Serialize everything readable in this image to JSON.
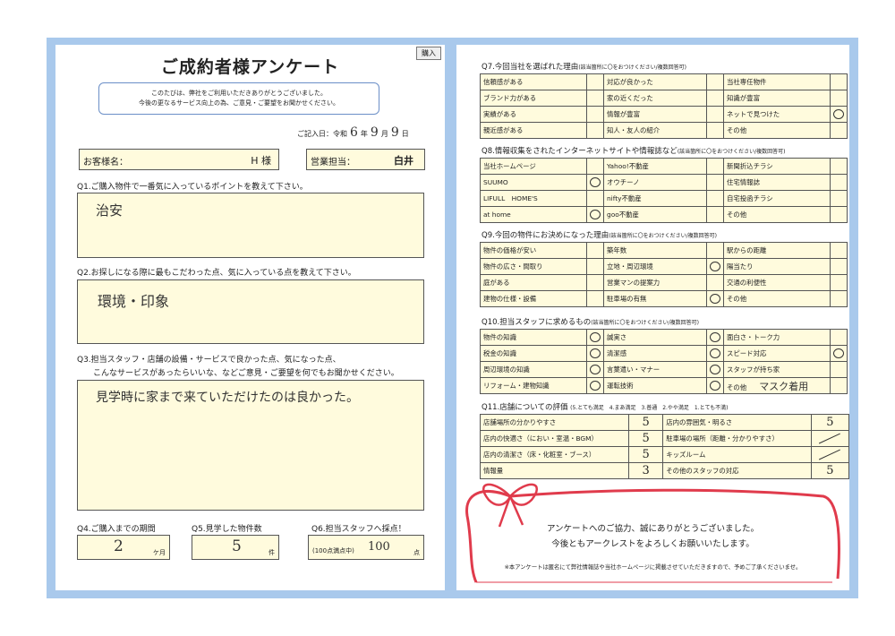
{
  "title": "ご成約者様アンケート",
  "badge": "購入",
  "thanks": {
    "line1": "このたびは、弊社をご利用いただきありがとうございました。",
    "line2": "今後の更なるサービス向上の為、ご意見・ご要望をお聞かせください。"
  },
  "fill_date": {
    "label": "ご記入日：令和",
    "year": "6",
    "year_unit": "年",
    "month": "9",
    "month_unit": "月",
    "day": "9",
    "day_unit": "日"
  },
  "customer": {
    "label": "お客様名：",
    "value": "H 様"
  },
  "sales": {
    "label": "営業担当：",
    "value": "白井"
  },
  "q1": {
    "question": "Q1.ご購入物件で一番気に入っているポイントを教えて下さい。",
    "answer": "治安"
  },
  "q2": {
    "question": "Q2.お探しになる際に最もこだわった点、気に入っている点を教えて下さい。",
    "answer": "環境・印象"
  },
  "q3": {
    "question_line1": "Q3.担当スタッフ・店舗の設備・サービスで良かった点、気になった点、",
    "question_line2": "こんなサービスがあったらいいな、などご意見・ご要望を何でもお聞かせください。",
    "answer": "見学時に家まで来ていただけたのは良かった。"
  },
  "q4": {
    "question": "Q4.ご購入までの期間",
    "value": "2",
    "unit": "ケ月"
  },
  "q5": {
    "question": "Q5.見学した物件数",
    "value": "5",
    "unit": "件"
  },
  "q6": {
    "question": "Q6.担当スタッフへ採点！",
    "prefix": "(100点満点中)",
    "value": "100",
    "unit": "点"
  },
  "q7": {
    "question": "Q7.今回当社を選ばれた理由",
    "note": "(該当箇所に〇をおつけください/複数回答可)",
    "rows": [
      [
        {
          "label": "信頼感がある",
          "mark": false
        },
        {
          "label": "対応が良かった",
          "mark": false
        },
        {
          "label": "当社専任物件",
          "mark": false
        }
      ],
      [
        {
          "label": "ブランド力がある",
          "mark": false
        },
        {
          "label": "家の近くだった",
          "mark": false
        },
        {
          "label": "知識が豊富",
          "mark": false
        }
      ],
      [
        {
          "label": "実績がある",
          "mark": false
        },
        {
          "label": "情報が豊富",
          "mark": false
        },
        {
          "label": "ネットで見つけた",
          "mark": true
        }
      ],
      [
        {
          "label": "親近感がある",
          "mark": false
        },
        {
          "label": "知人・友人の紹介",
          "mark": false
        },
        {
          "label": "その他",
          "mark": false
        }
      ]
    ]
  },
  "q8": {
    "question": "Q8.情報収集をされたインターネットサイトや情報誌など",
    "note": "(該当箇所に〇をおつけください/複数回答可)",
    "rows": [
      [
        {
          "label": "当社ホームページ",
          "mark": false
        },
        {
          "label": "Yahoo!不動産",
          "mark": false
        },
        {
          "label": "新聞折込チラシ",
          "mark": false
        }
      ],
      [
        {
          "label": "SUUMO",
          "mark": true
        },
        {
          "label": "オウチーノ",
          "mark": false
        },
        {
          "label": "住宅情報誌",
          "mark": false
        }
      ],
      [
        {
          "label": "LIFULL　HOME'S",
          "mark": false
        },
        {
          "label": "nifty不動産",
          "mark": false
        },
        {
          "label": "自宅投函チラシ",
          "mark": false
        }
      ],
      [
        {
          "label": "at home",
          "mark": true
        },
        {
          "label": "goo不動産",
          "mark": false
        },
        {
          "label": "その他",
          "mark": false
        }
      ]
    ]
  },
  "q9": {
    "question": "Q9.今回の物件にお決めになった理由",
    "note": "(該当箇所に〇をおつけください/複数回答可)",
    "rows": [
      [
        {
          "label": "物件の価格が安い",
          "mark": false
        },
        {
          "label": "築年数",
          "mark": false
        },
        {
          "label": "駅からの距離",
          "mark": false
        }
      ],
      [
        {
          "label": "物件の広さ・間取り",
          "mark": false
        },
        {
          "label": "立地・周辺環境",
          "mark": true
        },
        {
          "label": "陽当たり",
          "mark": false
        }
      ],
      [
        {
          "label": "庭がある",
          "mark": false
        },
        {
          "label": "営業マンの提案力",
          "mark": false
        },
        {
          "label": "交通の利便性",
          "mark": false
        }
      ],
      [
        {
          "label": "建物の仕様・設備",
          "mark": false
        },
        {
          "label": "駐車場の有無",
          "mark": true
        },
        {
          "label": "その他",
          "mark": false
        }
      ]
    ]
  },
  "q10": {
    "question": "Q10.担当スタッフに求めるもの",
    "note": "(該当箇所に〇をおつけください/複数回答可)",
    "rows": [
      [
        {
          "label": "物件の知識",
          "mark": true
        },
        {
          "label": "誠実さ",
          "mark": true
        },
        {
          "label": "面白さ・トーク力",
          "mark": false
        }
      ],
      [
        {
          "label": "税金の知識",
          "mark": true
        },
        {
          "label": "清潔感",
          "mark": true
        },
        {
          "label": "スピード対応",
          "mark": true
        }
      ],
      [
        {
          "label": "周辺環境の知識",
          "mark": true
        },
        {
          "label": "言葉遣い・マナー",
          "mark": true
        },
        {
          "label": "スタッフが持ち家",
          "mark": false
        }
      ],
      [
        {
          "label": "リフォーム・建物知識",
          "mark": true
        },
        {
          "label": "運転技術",
          "mark": true
        },
        {
          "label": "その他",
          "mark": false,
          "extra": "マスク着用"
        }
      ]
    ]
  },
  "q11": {
    "question": "Q11.店舗についての評価",
    "scale": "(5.とても満足　4.まあ満足　3.普通　2.やや満足　1.とても不満)",
    "rows": [
      [
        {
          "label": "店舗場所の分かりやすさ",
          "score": "5"
        },
        {
          "label": "店内の雰囲気・明るさ",
          "score": "5"
        }
      ],
      [
        {
          "label": "店内の快適さ（におい・室温・BGM）",
          "score": "5"
        },
        {
          "label": "駐車場の場所（距離・分かりやすさ）",
          "score": "/"
        }
      ],
      [
        {
          "label": "店内の清潔さ（床・化粧室・ブース）",
          "score": "5"
        },
        {
          "label": "キッズルーム",
          "score": "/"
        }
      ],
      [
        {
          "label": "情報量",
          "score": "3"
        },
        {
          "label": "その他のスタッフの対応",
          "score": "5"
        }
      ]
    ]
  },
  "closing": {
    "line1": "アンケートへのご協力、誠にありがとうございました。",
    "line2": "今後ともアークレストをよろしくお願いいたします。",
    "note": "※本アンケートは匿名にて弊社情報誌や当社ホームページに掲載させていただきますので、予めご了承くださいませ。"
  },
  "colors": {
    "frame": "#a9c9ec",
    "answer_bg": "#fffbdd",
    "ribbon": "#e03b4c",
    "thanks_border": "#6b8fc7"
  }
}
